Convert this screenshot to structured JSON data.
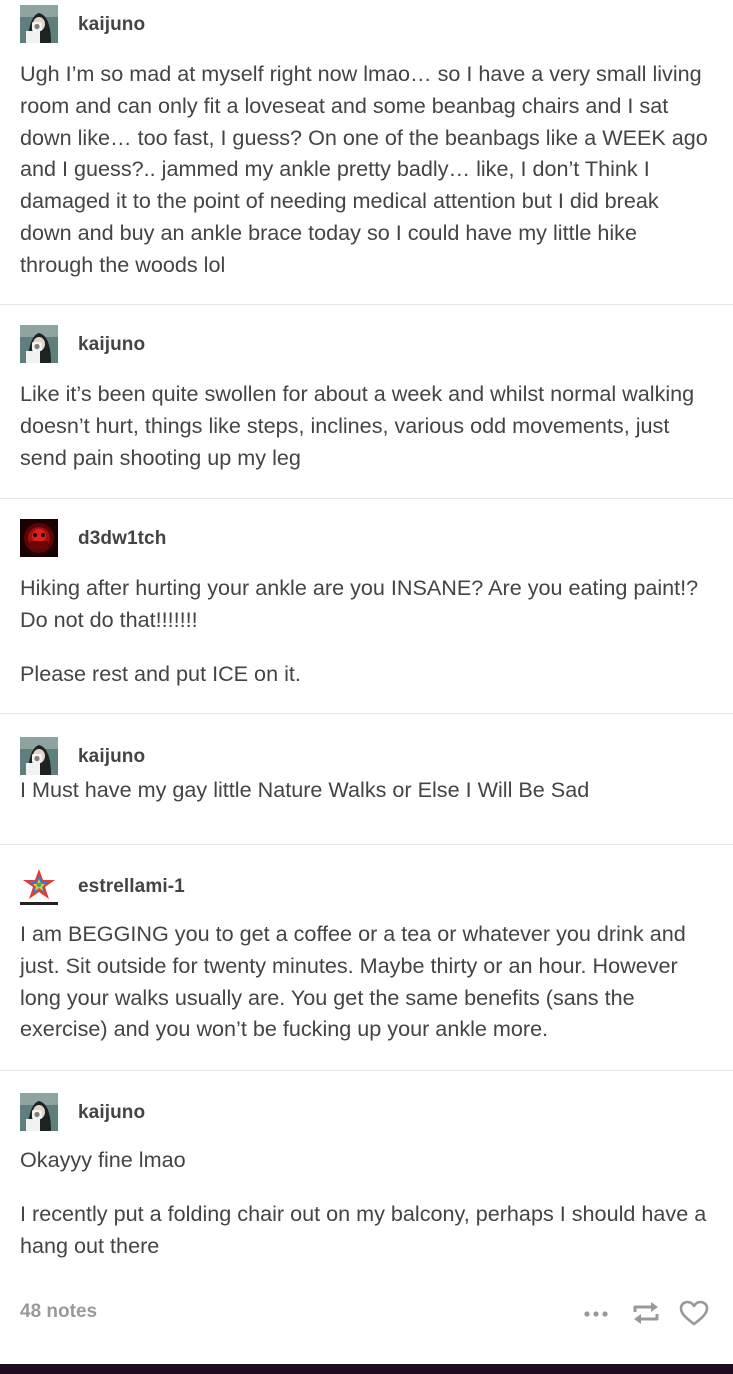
{
  "posts": [
    {
      "username": "kaijuno",
      "avatar": "kaijuno-avatar",
      "paragraphs": [
        "Ugh I’m so mad at myself right now lmao… so I have a very small living room and can only fit a loveseat and some beanbag chairs and I sat down like… too fast, I guess? On one of the beanbags like a WEEK ago and I guess?.. jammed my ankle pretty badly… like, I don’t Think I damaged it to the point of needing medical attention but I did break down and buy an ankle brace today so I could have my little hike through the woods lol"
      ]
    },
    {
      "username": "kaijuno",
      "avatar": "kaijuno-avatar",
      "paragraphs": [
        "Like it’s been quite swollen for about a week and whilst normal walking doesn’t hurt, things like steps, inclines, various odd movements, just send pain shooting up my leg"
      ]
    },
    {
      "username": "d3dw1tch",
      "avatar": "d3dw1tch-avatar",
      "paragraphs": [
        "Hiking after hurting your ankle are you INSANE? Are you eating paint!? Do not do that!!!!!!!",
        "Please rest and put ICE on it."
      ]
    },
    {
      "username": "kaijuno",
      "avatar": "kaijuno-avatar",
      "paragraphs": [
        "I Must have my gay little Nature Walks or Else I Will Be Sad"
      ]
    },
    {
      "username": "estrellami-1",
      "avatar": "estrellami-1-avatar",
      "paragraphs": [
        "I am BEGGING you to get a coffee or a tea or whatever you drink and just. Sit outside for twenty minutes. Maybe thirty or an hour. However long your walks usually are. You get the same benefits (sans the exercise) and you won’t be fucking up your ankle more."
      ]
    },
    {
      "username": "kaijuno",
      "avatar": "kaijuno-avatar",
      "paragraphs": [
        "Okayyy fine lmao",
        "I recently put a folding chair out on my balcony, perhaps I should have a hang out there"
      ]
    }
  ],
  "footer": {
    "notes": "48 notes",
    "actions": [
      "more-options-icon",
      "reblog-icon",
      "like-heart-icon"
    ]
  },
  "colors": {
    "text": "#444444",
    "notes": "#9a9a9a",
    "divider": "#e5e5e5",
    "icon": "#999999",
    "bottom_bar": "#1c0c1e"
  }
}
